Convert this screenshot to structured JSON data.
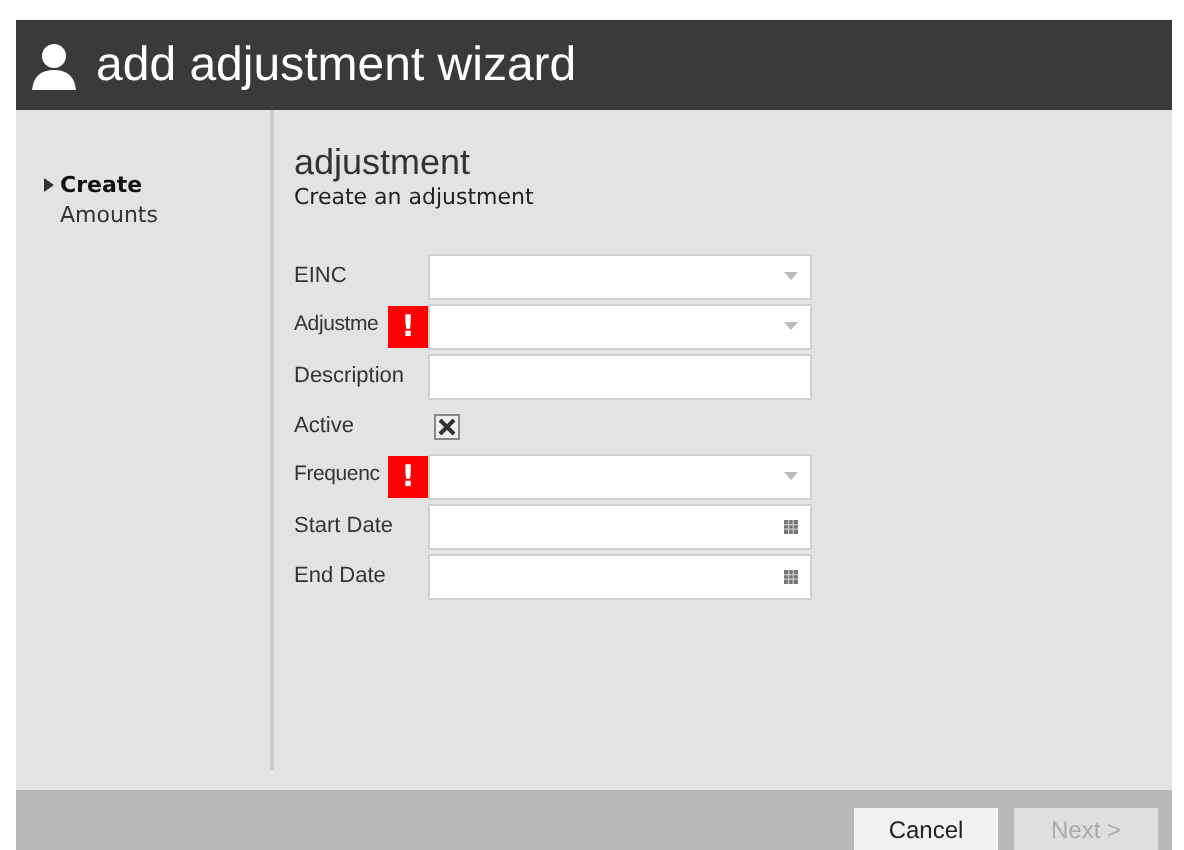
{
  "window": {
    "title": "add adjustment wizard"
  },
  "steps": [
    {
      "label": "Create",
      "selected": true
    },
    {
      "label": "Amounts",
      "selected": false
    }
  ],
  "section": {
    "title": "adjustment",
    "subtitle": "Create an adjustment"
  },
  "fields": [
    {
      "label": "EINC",
      "kind": "select",
      "error": false
    },
    {
      "label": "Adjustme",
      "kind": "select",
      "error": true,
      "error_mark": "!"
    },
    {
      "label": "Description",
      "kind": "text",
      "error": false
    },
    {
      "label": "Active",
      "kind": "checkbox",
      "checked": true,
      "error": false
    },
    {
      "label": "Frequenc",
      "kind": "select",
      "error": true,
      "error_mark": "!"
    },
    {
      "label": "Start Date",
      "kind": "date",
      "error": false
    },
    {
      "label": "End Date",
      "kind": "date",
      "error": false
    }
  ],
  "buttons": [
    {
      "label": "Cancel",
      "disabled": false
    },
    {
      "label": "Next >",
      "disabled": true
    }
  ]
}
